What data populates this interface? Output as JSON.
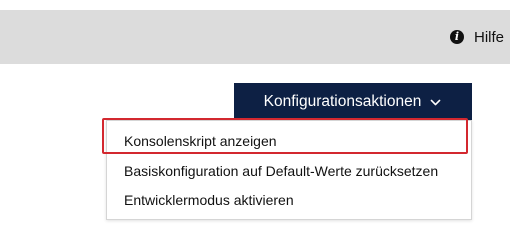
{
  "header": {
    "help_icon": "info-circle-icon",
    "help_label": "Hilfe"
  },
  "actions": {
    "button_label": "Konfigurationsaktionen",
    "button_icon": "chevron-down-icon",
    "button_color": "#0d2044"
  },
  "menu": {
    "items": [
      {
        "label": "Konsolenskript anzeigen",
        "highlighted": true
      },
      {
        "label": "Basiskonfiguration auf Default-Werte zurücksetzen",
        "highlighted": false
      },
      {
        "label": "Entwicklermodus aktivieren",
        "highlighted": false
      }
    ],
    "highlight_color": "#d3282f"
  }
}
